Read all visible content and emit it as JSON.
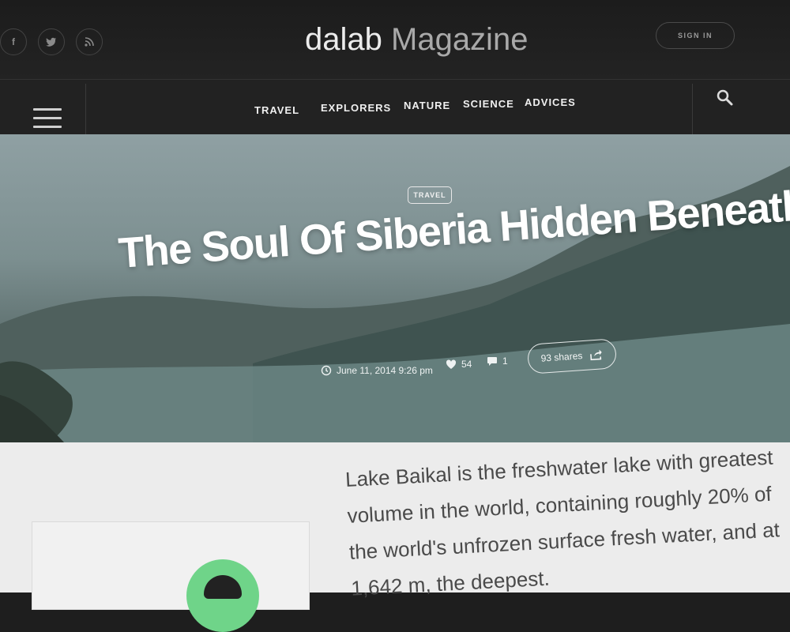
{
  "header": {
    "brand_bold": "dalab",
    "brand_light": "Magazine",
    "sign_in": "SIGN IN",
    "social_icons": [
      "facebook-icon",
      "twitter-icon",
      "rss-icon"
    ]
  },
  "nav": {
    "items": [
      "TRAVEL",
      "EXPLORERS",
      "NATURE",
      "SCIENCE",
      "ADVICES"
    ],
    "menu_icon": "hamburger-menu-icon",
    "search_icon": "search-icon"
  },
  "article": {
    "category": "TRAVEL",
    "title": "The Soul Of Siberia Hidden Beneath",
    "date": "June 11, 2014 9:26 pm",
    "likes": "54",
    "comments": "1",
    "shares": "93 shares",
    "body": "Lake Baikal is the freshwater lake with greatest volume in the world, containing roughly 20% of the world's unfrozen surface fresh water, and at 1,642 m, the deepest."
  },
  "colors": {
    "header_bg": "#1e1e1e",
    "nav_text": "#f0f0f0",
    "hero_overlay": "#5b6d6c",
    "avatar_green": "#6fd489"
  }
}
